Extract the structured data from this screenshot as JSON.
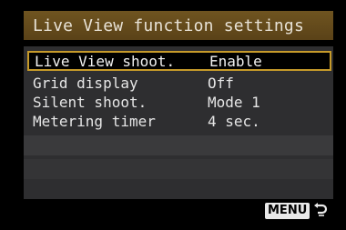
{
  "title": "Live View function settings",
  "items": [
    {
      "label": "Live View shoot.",
      "value": "Enable",
      "selected": true
    },
    {
      "label": "Grid display",
      "value": "Off"
    },
    {
      "label": "Silent shoot.",
      "value": "Mode 1"
    },
    {
      "label": "Metering timer",
      "value": "4 sec."
    }
  ],
  "footer": {
    "menu_label": "MENU",
    "return_icon": "return-arrow-icon"
  },
  "colors": {
    "title_bar": "#6f5420",
    "selection_border": "#c69a2a",
    "panel": "#2e2e30"
  }
}
